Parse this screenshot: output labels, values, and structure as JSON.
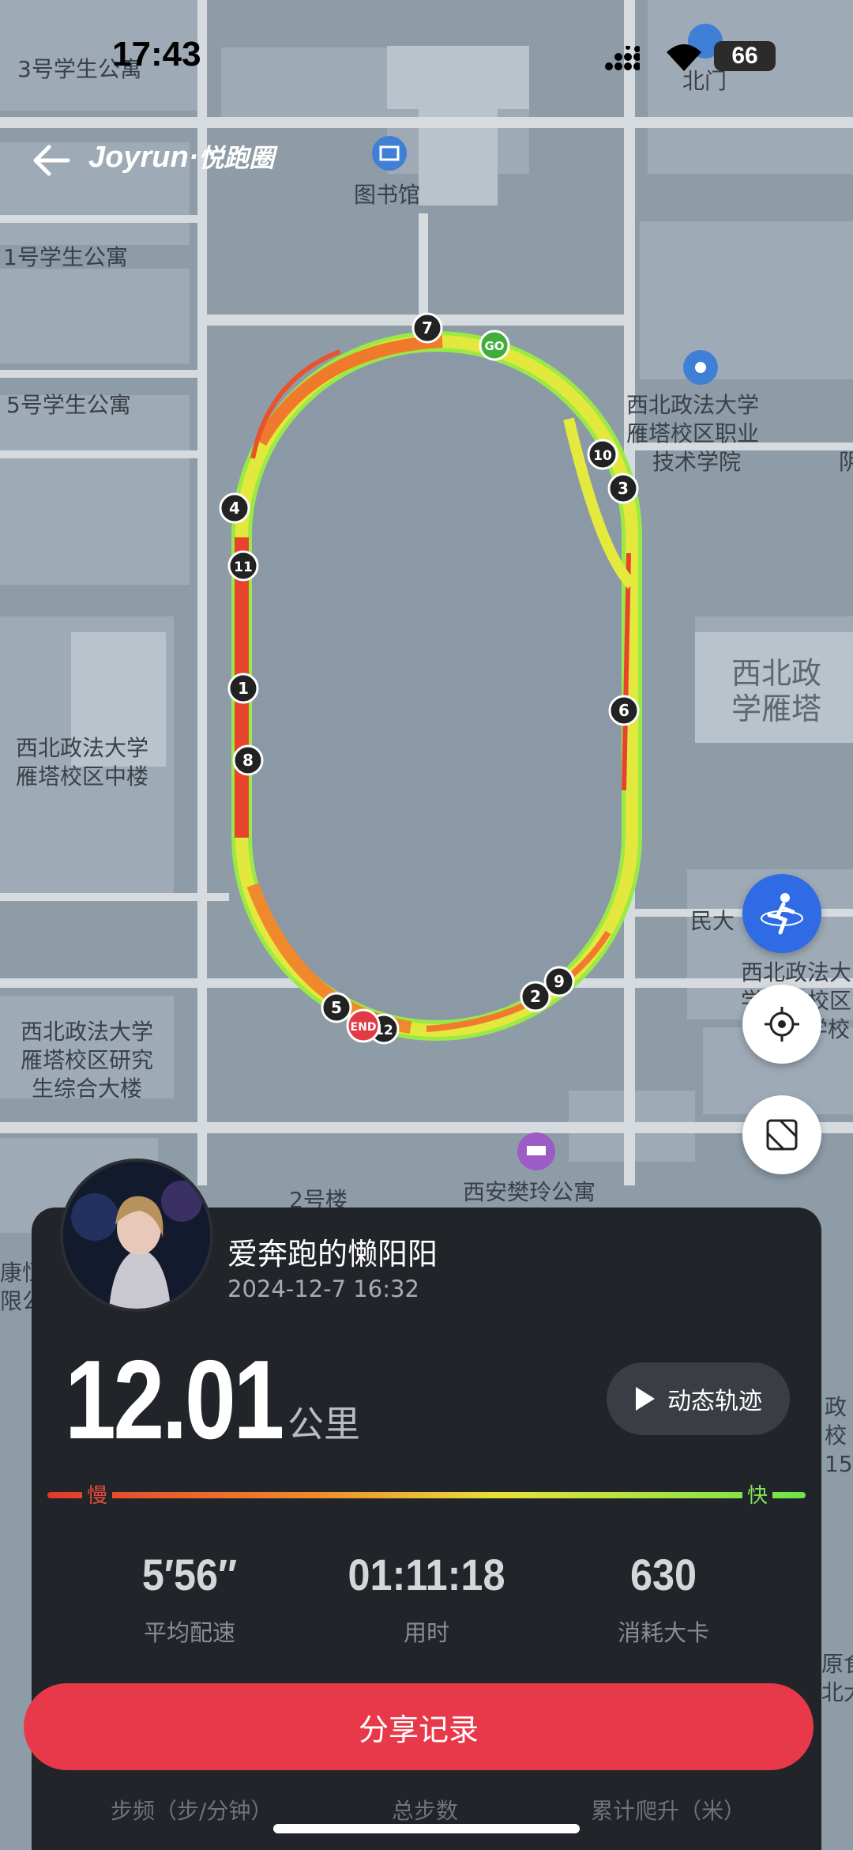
{
  "status_bar": {
    "time": "17:43",
    "battery": "66"
  },
  "header": {
    "brand": "Joyrun·",
    "brand_tag": "悦跑圈"
  },
  "map": {
    "labels": [
      "3号学生公寓",
      "北门",
      "图书馆",
      "1号学生公寓",
      "5号学生公寓",
      "西北政法大学",
      "雁塔校区职业",
      "技术学院",
      "阴",
      "西北政法大学",
      "雁塔校区中楼",
      "西北政法大学",
      "雁塔校区研究",
      "生综合大楼",
      "民大",
      "西北政",
      "学雁塔",
      "西北政法大",
      "学雁塔校区",
      "学校",
      "2号楼",
      "西安樊玲公寓",
      "政",
      "校",
      "15",
      "康恒",
      "限公",
      "原食",
      "北大"
    ],
    "kilometer_markers": [
      "1",
      "2",
      "3",
      "4",
      "5",
      "6",
      "7",
      "8",
      "9",
      "10",
      "11",
      "12"
    ],
    "start_label": "GO",
    "end_label": "END"
  },
  "user": {
    "name": "爱奔跑的懒阳阳",
    "date": "2024-12-7 16:32"
  },
  "run": {
    "distance": "12.01",
    "distance_unit": "公里"
  },
  "replay_button": {
    "label": "动态轨迹"
  },
  "speed_legend": {
    "slow": "慢",
    "fast": "快"
  },
  "stats": [
    {
      "value": "5′56″",
      "label": "平均配速"
    },
    {
      "value": "01:11:18",
      "label": "用时"
    },
    {
      "value": "630",
      "label": "消耗大卡"
    }
  ],
  "share_button": {
    "label": "分享记录"
  },
  "bottom_peek": [
    "步频（步/分钟）",
    "总步数",
    "累计爬升（米）"
  ],
  "colors": {
    "accent": "#e8394b",
    "slow": "#e84a3c",
    "fast": "#7fe356",
    "card": "#212428",
    "map_road": "#d9dde2",
    "map_block": "#9aa7b2"
  }
}
